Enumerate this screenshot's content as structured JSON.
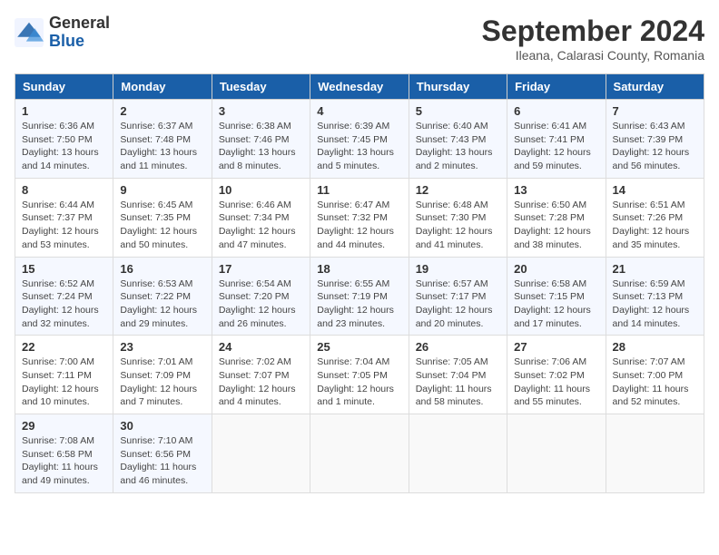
{
  "header": {
    "logo_general": "General",
    "logo_blue": "Blue",
    "month_title": "September 2024",
    "subtitle": "Ileana, Calarasi County, Romania"
  },
  "weekdays": [
    "Sunday",
    "Monday",
    "Tuesday",
    "Wednesday",
    "Thursday",
    "Friday",
    "Saturday"
  ],
  "weeks": [
    [
      {
        "day": "1",
        "info": "Sunrise: 6:36 AM\nSunset: 7:50 PM\nDaylight: 13 hours and 14 minutes."
      },
      {
        "day": "2",
        "info": "Sunrise: 6:37 AM\nSunset: 7:48 PM\nDaylight: 13 hours and 11 minutes."
      },
      {
        "day": "3",
        "info": "Sunrise: 6:38 AM\nSunset: 7:46 PM\nDaylight: 13 hours and 8 minutes."
      },
      {
        "day": "4",
        "info": "Sunrise: 6:39 AM\nSunset: 7:45 PM\nDaylight: 13 hours and 5 minutes."
      },
      {
        "day": "5",
        "info": "Sunrise: 6:40 AM\nSunset: 7:43 PM\nDaylight: 13 hours and 2 minutes."
      },
      {
        "day": "6",
        "info": "Sunrise: 6:41 AM\nSunset: 7:41 PM\nDaylight: 12 hours and 59 minutes."
      },
      {
        "day": "7",
        "info": "Sunrise: 6:43 AM\nSunset: 7:39 PM\nDaylight: 12 hours and 56 minutes."
      }
    ],
    [
      {
        "day": "8",
        "info": "Sunrise: 6:44 AM\nSunset: 7:37 PM\nDaylight: 12 hours and 53 minutes."
      },
      {
        "day": "9",
        "info": "Sunrise: 6:45 AM\nSunset: 7:35 PM\nDaylight: 12 hours and 50 minutes."
      },
      {
        "day": "10",
        "info": "Sunrise: 6:46 AM\nSunset: 7:34 PM\nDaylight: 12 hours and 47 minutes."
      },
      {
        "day": "11",
        "info": "Sunrise: 6:47 AM\nSunset: 7:32 PM\nDaylight: 12 hours and 44 minutes."
      },
      {
        "day": "12",
        "info": "Sunrise: 6:48 AM\nSunset: 7:30 PM\nDaylight: 12 hours and 41 minutes."
      },
      {
        "day": "13",
        "info": "Sunrise: 6:50 AM\nSunset: 7:28 PM\nDaylight: 12 hours and 38 minutes."
      },
      {
        "day": "14",
        "info": "Sunrise: 6:51 AM\nSunset: 7:26 PM\nDaylight: 12 hours and 35 minutes."
      }
    ],
    [
      {
        "day": "15",
        "info": "Sunrise: 6:52 AM\nSunset: 7:24 PM\nDaylight: 12 hours and 32 minutes."
      },
      {
        "day": "16",
        "info": "Sunrise: 6:53 AM\nSunset: 7:22 PM\nDaylight: 12 hours and 29 minutes."
      },
      {
        "day": "17",
        "info": "Sunrise: 6:54 AM\nSunset: 7:20 PM\nDaylight: 12 hours and 26 minutes."
      },
      {
        "day": "18",
        "info": "Sunrise: 6:55 AM\nSunset: 7:19 PM\nDaylight: 12 hours and 23 minutes."
      },
      {
        "day": "19",
        "info": "Sunrise: 6:57 AM\nSunset: 7:17 PM\nDaylight: 12 hours and 20 minutes."
      },
      {
        "day": "20",
        "info": "Sunrise: 6:58 AM\nSunset: 7:15 PM\nDaylight: 12 hours and 17 minutes."
      },
      {
        "day": "21",
        "info": "Sunrise: 6:59 AM\nSunset: 7:13 PM\nDaylight: 12 hours and 14 minutes."
      }
    ],
    [
      {
        "day": "22",
        "info": "Sunrise: 7:00 AM\nSunset: 7:11 PM\nDaylight: 12 hours and 10 minutes."
      },
      {
        "day": "23",
        "info": "Sunrise: 7:01 AM\nSunset: 7:09 PM\nDaylight: 12 hours and 7 minutes."
      },
      {
        "day": "24",
        "info": "Sunrise: 7:02 AM\nSunset: 7:07 PM\nDaylight: 12 hours and 4 minutes."
      },
      {
        "day": "25",
        "info": "Sunrise: 7:04 AM\nSunset: 7:05 PM\nDaylight: 12 hours and 1 minute."
      },
      {
        "day": "26",
        "info": "Sunrise: 7:05 AM\nSunset: 7:04 PM\nDaylight: 11 hours and 58 minutes."
      },
      {
        "day": "27",
        "info": "Sunrise: 7:06 AM\nSunset: 7:02 PM\nDaylight: 11 hours and 55 minutes."
      },
      {
        "day": "28",
        "info": "Sunrise: 7:07 AM\nSunset: 7:00 PM\nDaylight: 11 hours and 52 minutes."
      }
    ],
    [
      {
        "day": "29",
        "info": "Sunrise: 7:08 AM\nSunset: 6:58 PM\nDaylight: 11 hours and 49 minutes."
      },
      {
        "day": "30",
        "info": "Sunrise: 7:10 AM\nSunset: 6:56 PM\nDaylight: 11 hours and 46 minutes."
      },
      {
        "day": "",
        "info": ""
      },
      {
        "day": "",
        "info": ""
      },
      {
        "day": "",
        "info": ""
      },
      {
        "day": "",
        "info": ""
      },
      {
        "day": "",
        "info": ""
      }
    ]
  ]
}
